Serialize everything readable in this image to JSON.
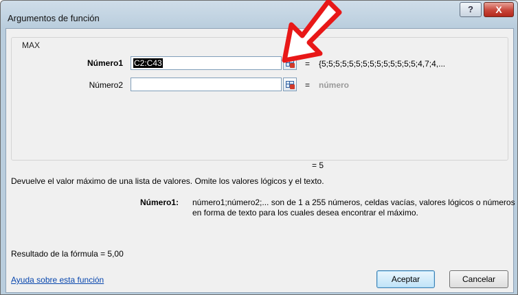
{
  "window": {
    "title": "Argumentos de función",
    "help_label": "?",
    "close_label": "X"
  },
  "function_name": "MAX",
  "arguments": [
    {
      "label": "Número1",
      "value": "C2:C43",
      "result": "{5;5;5;5;5;5;5;5;5;5;5;5;5;5;4,7;4,..."
    },
    {
      "label": "Número2",
      "value": "",
      "result": "número"
    }
  ],
  "equals": "=",
  "function_result": "= 5",
  "description": "Devuelve el valor máximo de una lista de valores. Omite los valores lógicos y el texto.",
  "argument_help": {
    "label": "Número1:",
    "text": "número1;número2;... son de 1 a 255 números, celdas vacías, valores lógicos o números en forma de texto para los cuales desea encontrar el máximo."
  },
  "formula_result": "Resultado de la fórmula =   5,00",
  "help_link": "Ayuda sobre esta función",
  "buttons": {
    "ok": "Aceptar",
    "cancel": "Cancelar"
  },
  "colors": {
    "arrow_fill": "#ffffff",
    "arrow_stroke": "#e81818"
  }
}
